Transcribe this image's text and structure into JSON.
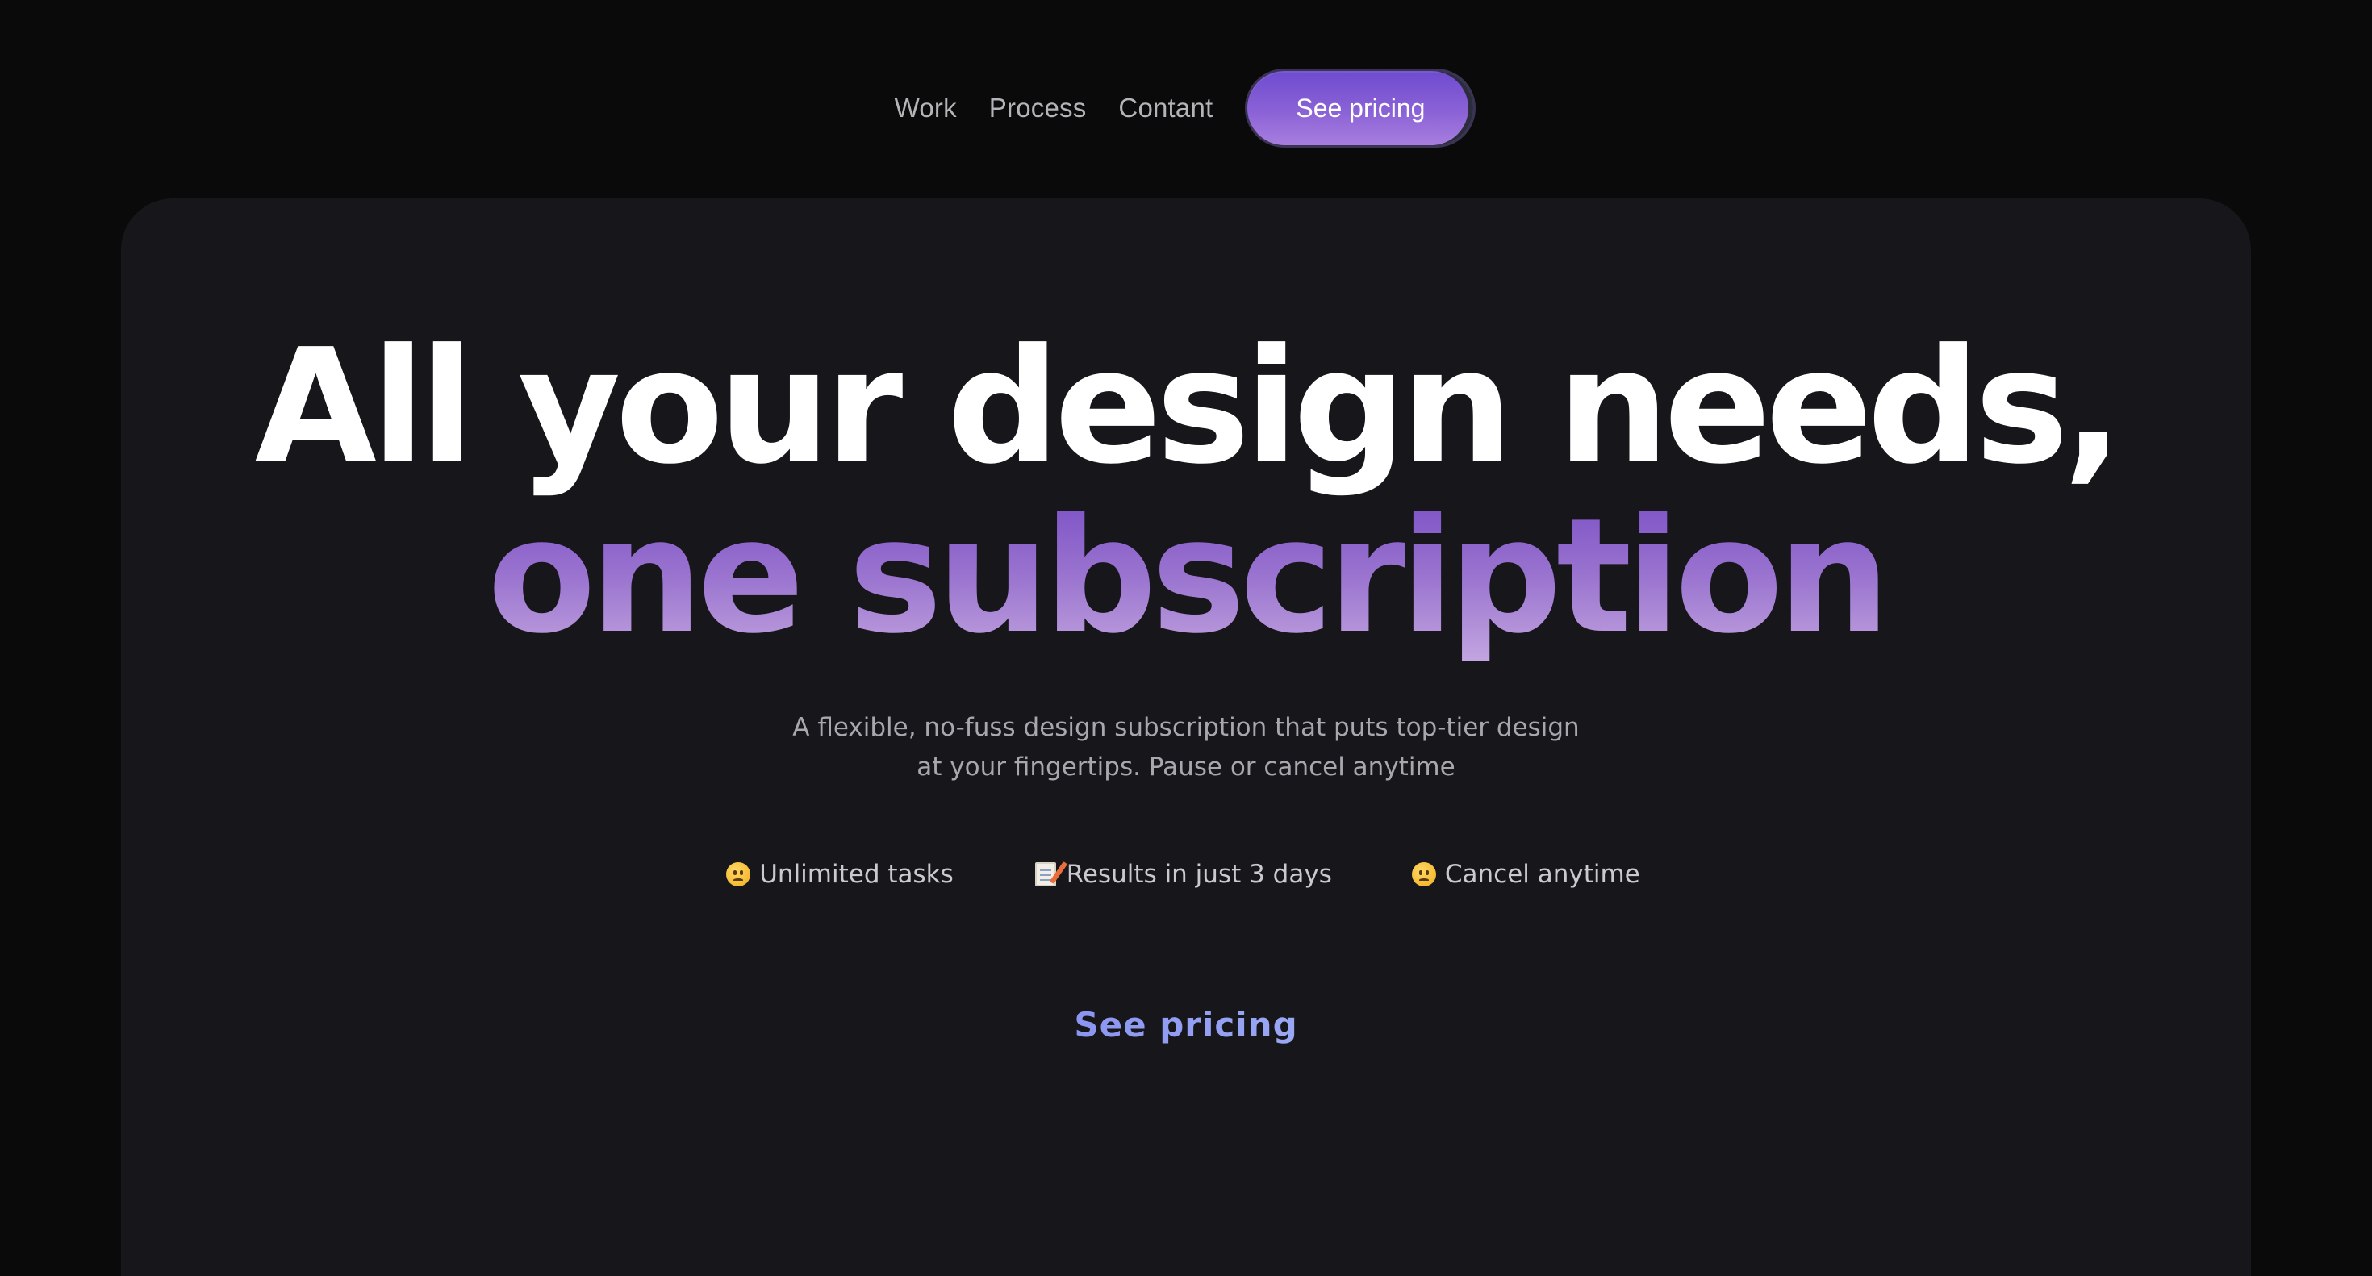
{
  "nav": {
    "links": [
      "Work",
      "Process",
      "Contant"
    ],
    "cta_label": "See pricing"
  },
  "hero": {
    "headline_line1": "All your design needs,",
    "headline_line2": "one subscription",
    "subtitle_line1": "A flexible, no-fuss design subscription that puts top-tier design",
    "subtitle_line2": "at your fingertips. Pause or cancel anytime",
    "features": [
      {
        "icon": "worried-face-icon",
        "label": "Unlimited tasks"
      },
      {
        "icon": "memo-icon",
        "label": "Results in just 3 days"
      },
      {
        "icon": "sad-face-icon",
        "label": "Cancel anytime"
      }
    ],
    "cta_label": "See pricing"
  },
  "colors": {
    "background": "#0a0a0b",
    "card": "#16161b",
    "accent_purple": "#8b62d6",
    "link_blue": "#8f9cf0"
  }
}
